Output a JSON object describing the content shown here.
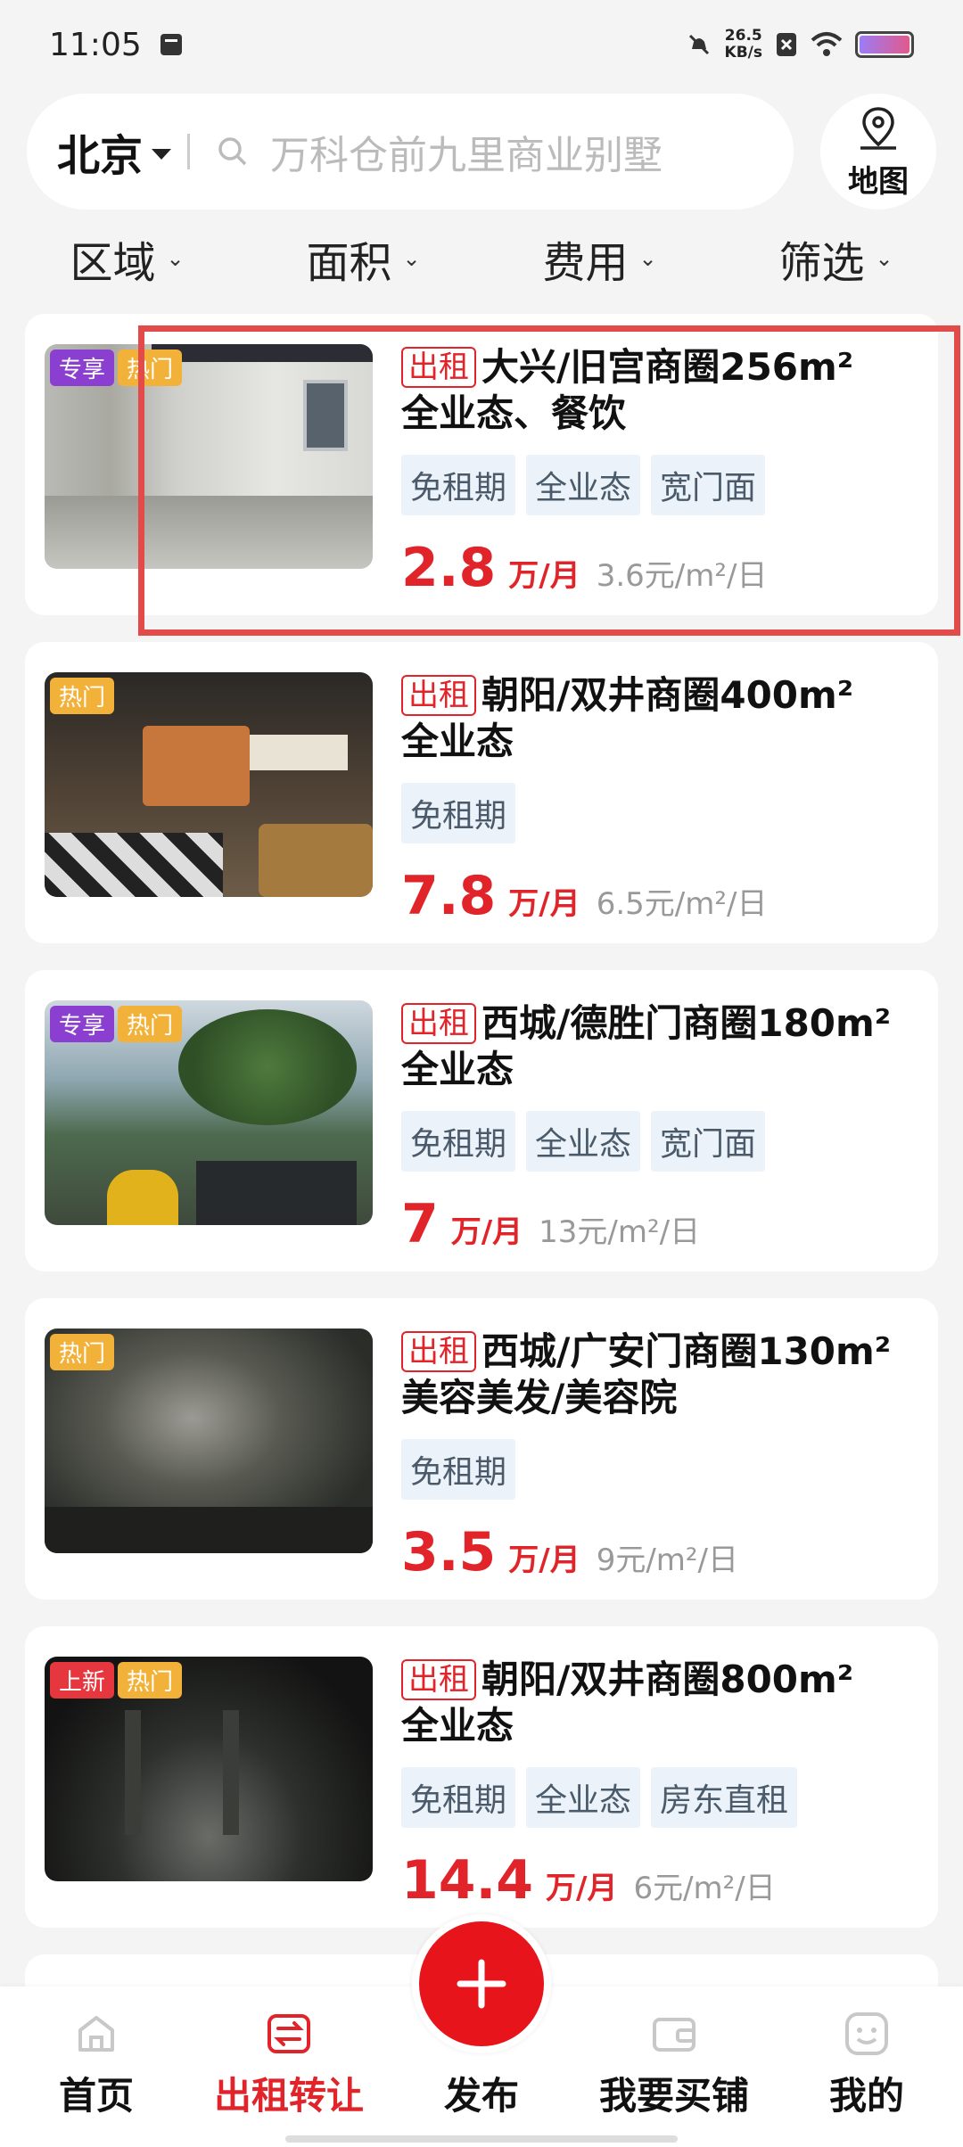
{
  "status": {
    "time": "11:05",
    "net_speed_value": "26.5",
    "net_speed_unit": "KB/s"
  },
  "search": {
    "city": "北京",
    "placeholder": "万科仓前九里商业别墅",
    "map_label": "地图"
  },
  "filters": [
    {
      "label": "区域"
    },
    {
      "label": "面积"
    },
    {
      "label": "费用"
    },
    {
      "label": "筛选"
    }
  ],
  "listings": [
    {
      "badges": [
        "专享",
        "热门"
      ],
      "tag": "出租",
      "title": "大兴/旧宫商圈256m²",
      "subtitle": "全业态、餐饮",
      "features": [
        "免租期",
        "全业态",
        "宽门面"
      ],
      "price": "2.8",
      "price_unit": "万/月",
      "price_per": "3.6元/m²/日"
    },
    {
      "badges": [
        "热门"
      ],
      "tag": "出租",
      "title": "朝阳/双井商圈400m²",
      "subtitle": "全业态",
      "features": [
        "免租期"
      ],
      "price": "7.8",
      "price_unit": "万/月",
      "price_per": "6.5元/m²/日"
    },
    {
      "badges": [
        "专享",
        "热门"
      ],
      "tag": "出租",
      "title": "西城/德胜门商圈180m²",
      "subtitle": "全业态",
      "features": [
        "免租期",
        "全业态",
        "宽门面"
      ],
      "price": "7",
      "price_unit": "万/月",
      "price_per": "13元/m²/日"
    },
    {
      "badges": [
        "热门"
      ],
      "tag": "出租",
      "title": "西城/广安门商圈130m²",
      "subtitle": "美容美发/美容院",
      "features": [
        "免租期"
      ],
      "price": "3.5",
      "price_unit": "万/月",
      "price_per": "9元/m²/日"
    },
    {
      "badges": [
        "上新",
        "热门"
      ],
      "tag": "出租",
      "title": "朝阳/双井商圈800m²",
      "subtitle": "全业态",
      "features": [
        "免租期",
        "全业态",
        "房东直租"
      ],
      "price": "14.4",
      "price_unit": "万/月",
      "price_per": "6元/m²/日"
    }
  ],
  "tabbar": [
    {
      "label": "首页"
    },
    {
      "label": "出租转让"
    },
    {
      "label": "发布"
    },
    {
      "label": "我要买铺"
    },
    {
      "label": "我的"
    }
  ],
  "colors": {
    "accent": "#e0242a",
    "badge_exclusive": "#8b3fd0",
    "badge_hot": "#f2b23a",
    "badge_new": "#e6373e",
    "highlight": "#e34b4b"
  }
}
